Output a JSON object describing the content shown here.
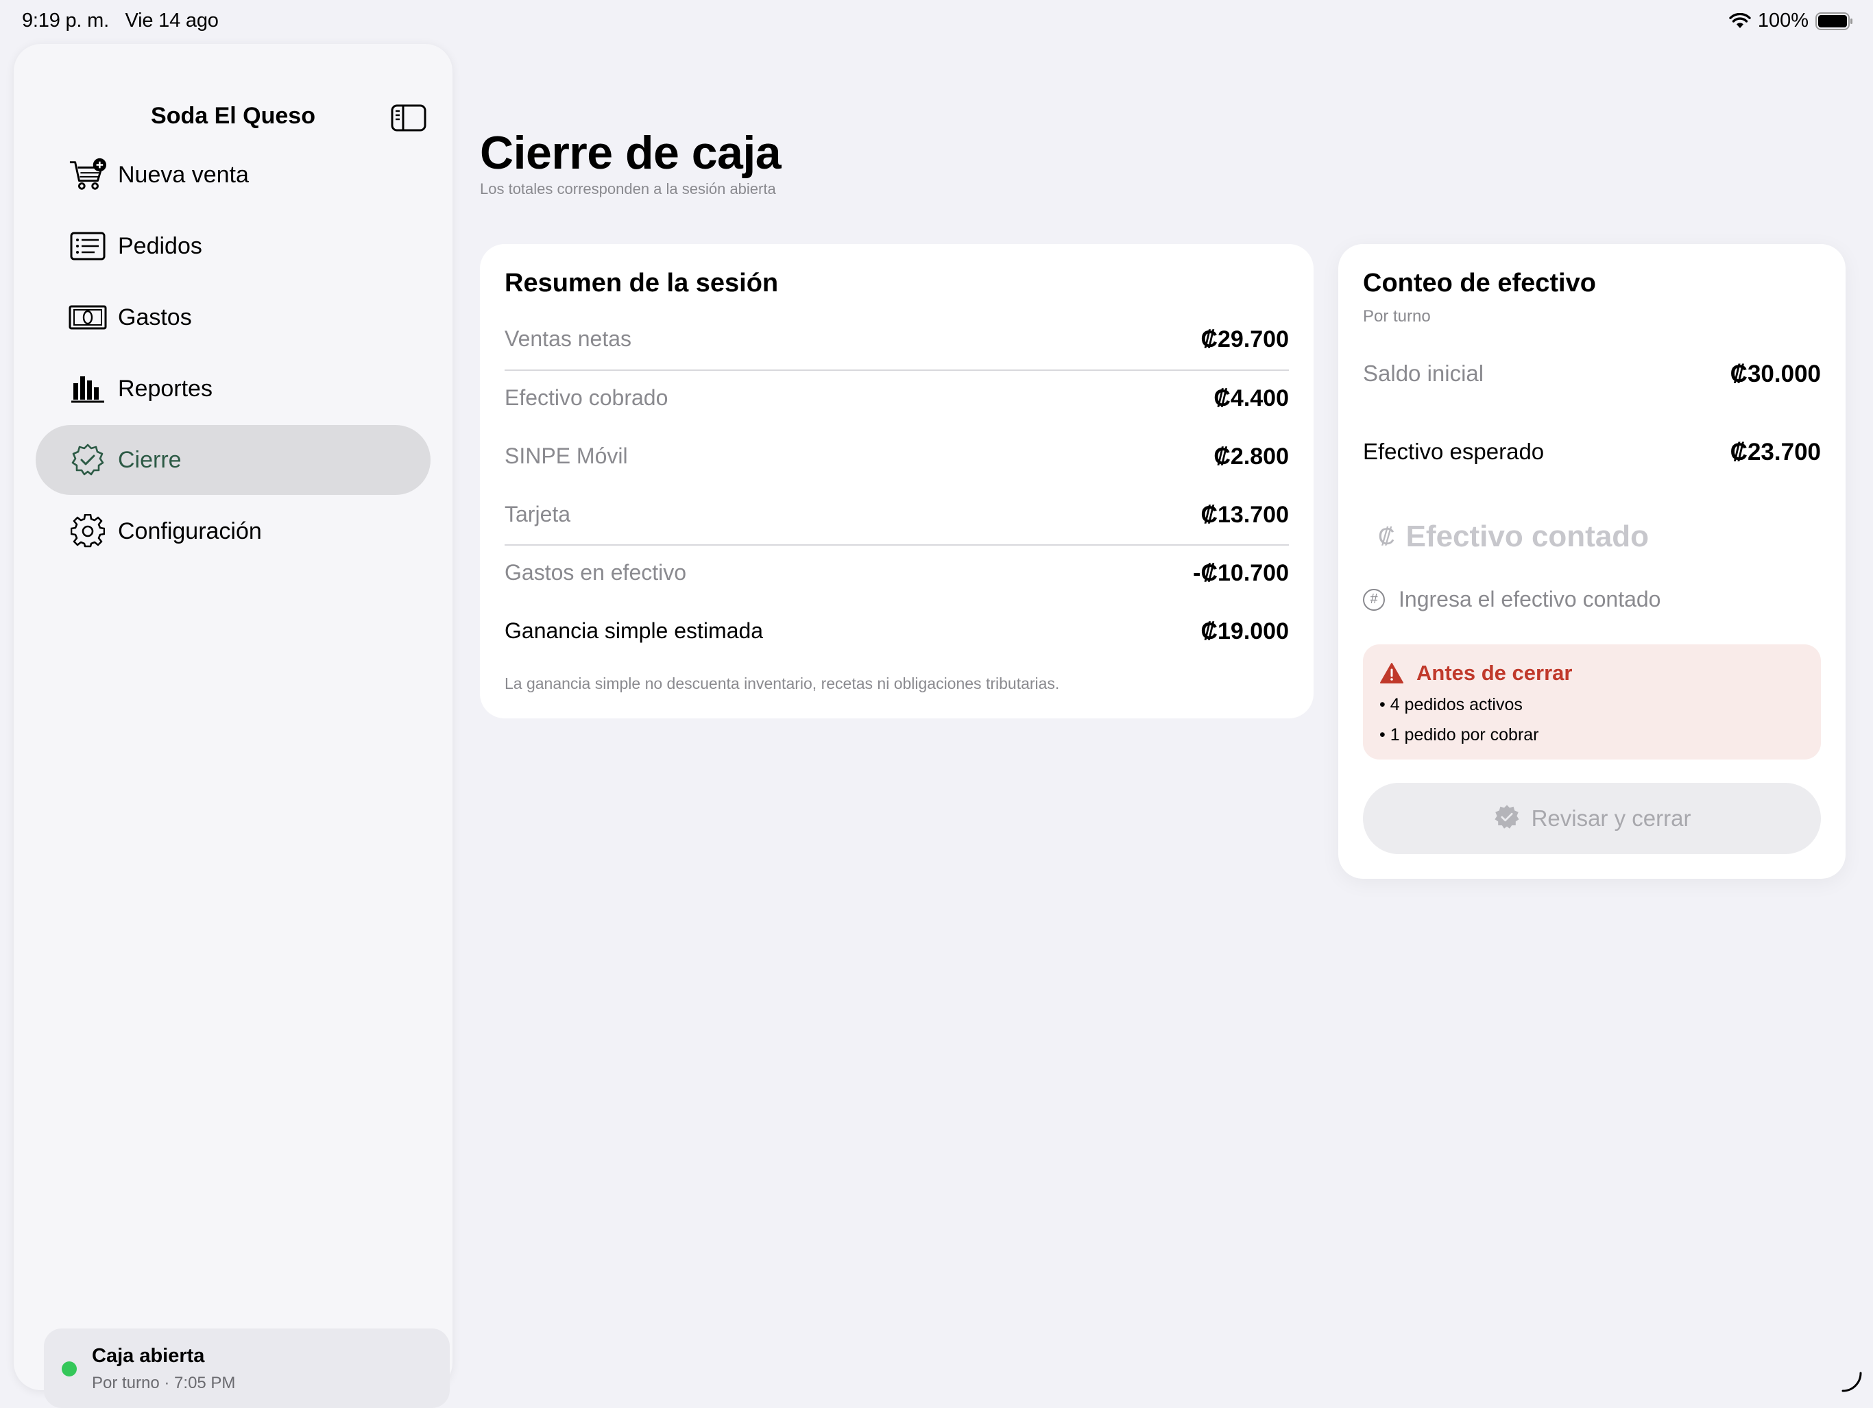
{
  "status_bar": {
    "time": "9:19 p. m.   Vie 14 ago",
    "battery": "100%"
  },
  "sidebar": {
    "title": "Soda El Queso",
    "items": [
      {
        "label": "Nueva venta",
        "icon": "cart-plus-icon"
      },
      {
        "label": "Pedidos",
        "icon": "list-icon"
      },
      {
        "label": "Gastos",
        "icon": "banknote-icon"
      },
      {
        "label": "Reportes",
        "icon": "bar-chart-icon"
      },
      {
        "label": "Cierre",
        "icon": "checkmark-seal-icon",
        "active": true
      },
      {
        "label": "Configuración",
        "icon": "gear-icon"
      }
    ],
    "session": {
      "title": "Caja abierta",
      "subtitle": "Por turno · 7:05 PM",
      "status_color": "#34c759"
    }
  },
  "header": {
    "title": "Cierre de caja",
    "subtitle": "Los totales corresponden a la sesión abierta"
  },
  "summary": {
    "heading": "Resumen de la sesión",
    "rows": [
      {
        "label": "Ventas netas",
        "value": "₡29.700"
      },
      {
        "label": "Efectivo cobrado",
        "value": "₡4.400"
      },
      {
        "label": "SINPE Móvil",
        "value": "₡2.800"
      },
      {
        "label": "Tarjeta",
        "value": "₡13.700"
      },
      {
        "label": "Gastos en efectivo",
        "value": "-₡10.700"
      },
      {
        "label": "Ganancia simple estimada",
        "value": "₡19.000"
      }
    ],
    "footnote": "La ganancia simple no descuenta inventario, recetas ni obligaciones tributarias."
  },
  "cash_count": {
    "heading": "Conteo de efectivo",
    "subtitle": "Por turno",
    "opening_label": "Saldo inicial",
    "opening_value": "₡30.000",
    "expected_label": "Efectivo esperado",
    "expected_value": "₡23.700",
    "currency_symbol": "₡",
    "input_placeholder": "Efectivo contado",
    "hint": "Ingresa el efectivo contado",
    "warning": {
      "title": "Antes de cerrar",
      "items": [
        "• 4 pedidos activos",
        "• 1 pedido por cobrar"
      ],
      "color": "#c0392b"
    },
    "button_label": "Revisar y cerrar"
  }
}
